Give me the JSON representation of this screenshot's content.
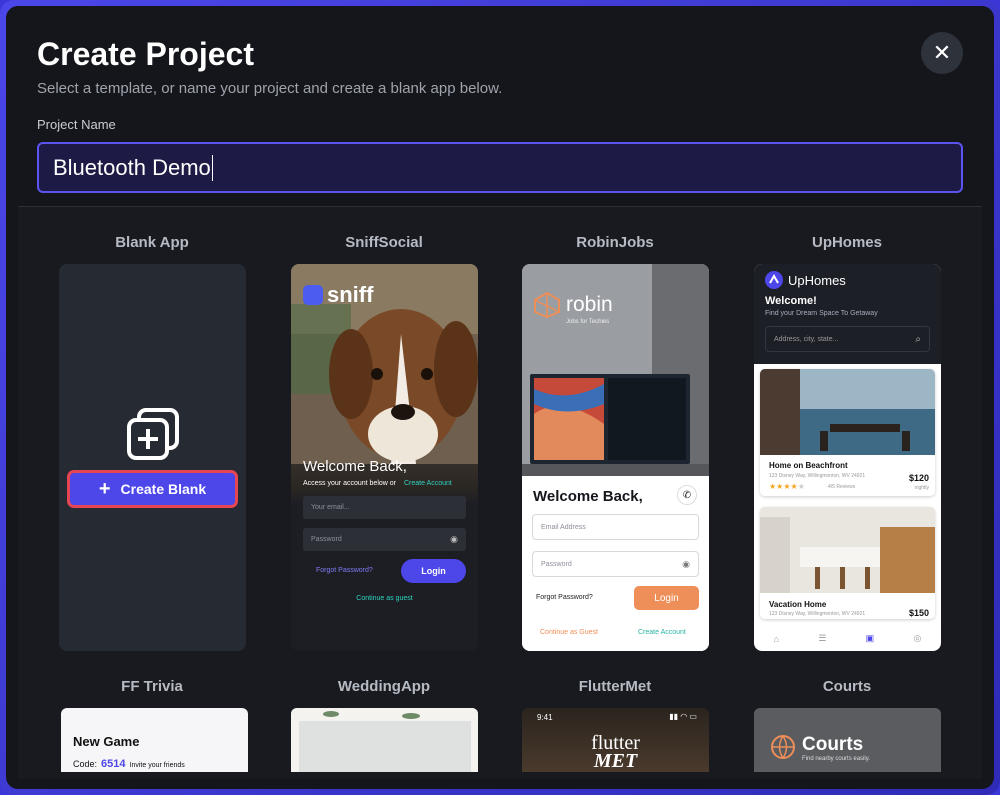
{
  "dialog": {
    "title": "Create Project",
    "subtitle": "Select a template, or name your project and create a blank app below.",
    "close_icon": "close-icon"
  },
  "project_name": {
    "label": "Project Name",
    "value": "Bluetooth Demo"
  },
  "templates": {
    "row1": [
      {
        "name": "Blank App"
      },
      {
        "name": "SniffSocial"
      },
      {
        "name": "RobinJobs"
      },
      {
        "name": "UpHomes"
      }
    ],
    "row2": [
      {
        "name": "FF Trivia"
      },
      {
        "name": "WeddingApp"
      },
      {
        "name": "FlutterMet"
      },
      {
        "name": "Courts"
      }
    ]
  },
  "blank": {
    "button_label": "Create Blank",
    "icon": "add-pages-icon"
  },
  "sniff": {
    "logo": "sniff",
    "heading": "Welcome Back,",
    "sub": "Access your account below or",
    "create_link": "Create Account",
    "email_placeholder": "Your email...",
    "password_placeholder": "Password",
    "forgot": "Forgot Password?",
    "login": "Login",
    "guest": "Continue as guest"
  },
  "robin": {
    "logo": "robin",
    "tagline": "Jobs for Techies",
    "heading": "Welcome Back,",
    "email_placeholder": "Email Address",
    "password_placeholder": "Password",
    "forgot": "Forgot Password?",
    "login": "Login",
    "guest": "Continue as Guest",
    "create": "Create Account"
  },
  "uphomes": {
    "logo": "UpHomes",
    "welcome": "Welcome!",
    "tagline": "Find your Dream Space To Getaway",
    "search_placeholder": "Address, city, state...",
    "listing1": {
      "title": "Home on Beachfront",
      "address": "123 Disney Way, Willingmonton, WV 24921",
      "reviews": "4/5 Reviews",
      "price": "$120",
      "unit": "nightly"
    },
    "listing2": {
      "title": "Vacation Home",
      "address": "123 Disney Way, Willingmonton, WV 24921",
      "price": "$150"
    }
  },
  "trivia": {
    "heading": "New Game",
    "code_label": "Code:",
    "code": "6514",
    "invite": "Invite your friends"
  },
  "fluttermet": {
    "time": "9:41",
    "logo_top": "flutter",
    "logo_bottom": "MET"
  },
  "courts": {
    "title": "Courts",
    "tagline": "Find nearby courts easily."
  },
  "colors": {
    "accent": "#4d46e8",
    "danger_outline": "#e64554",
    "teal": "#2dd4bf",
    "orange": "#ee8e58"
  }
}
